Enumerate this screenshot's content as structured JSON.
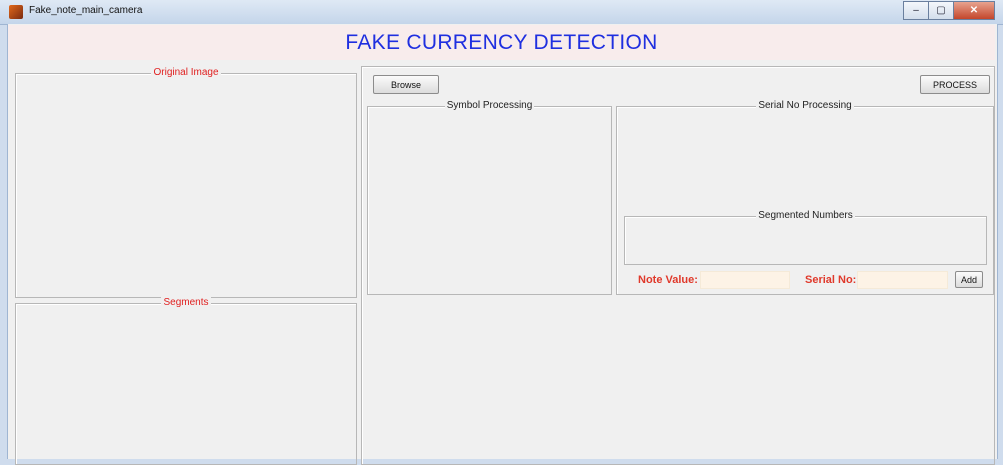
{
  "window": {
    "title": "Fake_note_main_camera"
  },
  "banner": {
    "title": "FAKE CURRENCY DETECTION"
  },
  "panels": {
    "original": "Original Image",
    "segments": "Segments",
    "symbol": "Symbol Processing",
    "serial": "Serial No Processing",
    "segmented_numbers": "Segmented Numbers"
  },
  "buttons": {
    "browse": "Browse",
    "process": "PROCESS",
    "add": "Add"
  },
  "fields": {
    "note_value_label": "Note Value:",
    "note_value": "",
    "serial_label": "Serial No:",
    "serial": ""
  },
  "colors": {
    "title_blue": "#1f2fe0",
    "label_red": "#e02020",
    "banner_bg": "#f8ecec"
  }
}
